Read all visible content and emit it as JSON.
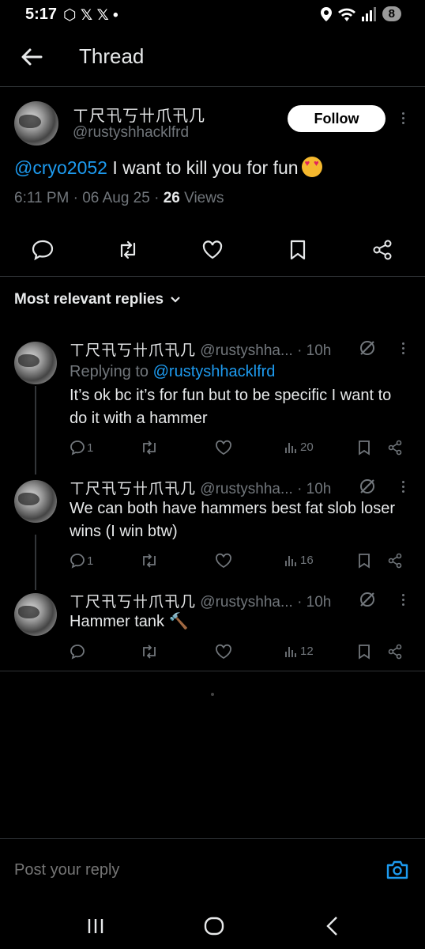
{
  "status_bar": {
    "time": "5:17",
    "left_icons": "⬡ 𝕏 𝕏 •",
    "battery": "8"
  },
  "header": {
    "title": "Thread"
  },
  "main_tweet": {
    "name": "ㄒ尺卂丂卄爪卂几",
    "handle": "@rustyshhacklfrd",
    "follow_label": "Follow",
    "mention": "@cryo2052",
    "text": " I want to kill you for fun",
    "time": "6:11 PM · 06 Aug 25 · ",
    "views_count": "26",
    "views_label": " Views"
  },
  "sort": {
    "label": "Most relevant replies"
  },
  "replies": [
    {
      "name": "ㄒ尺卂丂卄爪卂几",
      "handle": " @rustyshha... · 10h",
      "replying_prefix": "Replying to ",
      "replying_handle": "@rustyshhacklfrd",
      "text": "It’s ok bc it’s for fun but to be specific I want to do it with a hammer",
      "reply_count": "1",
      "views": "20"
    },
    {
      "name": "ㄒ尺卂丂卄爪卂几",
      "handle": " @rustyshha... · 10h",
      "text": "We can both have hammers best fat slob loser wins (I win btw)",
      "reply_count": "1",
      "views": "16"
    },
    {
      "name": "ㄒ尺卂丂卄爪卂几",
      "handle": " @rustyshha... · 10h",
      "text": "Hammer tank 🔨",
      "reply_count": "",
      "views": "12"
    }
  ],
  "composer": {
    "placeholder": "Post your reply"
  }
}
